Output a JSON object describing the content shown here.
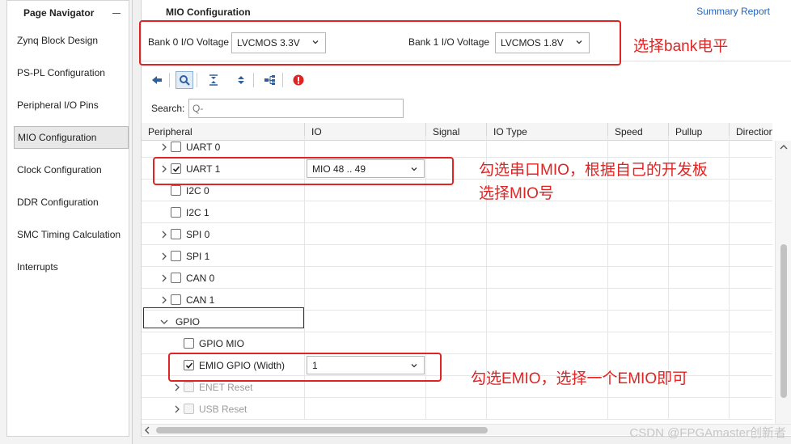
{
  "navigator": {
    "title": "Page Navigator",
    "items": [
      {
        "label": "Zynq Block Design"
      },
      {
        "label": "PS-PL Configuration"
      },
      {
        "label": "Peripheral I/O Pins"
      },
      {
        "label": "MIO Configuration",
        "active": true
      },
      {
        "label": "Clock Configuration"
      },
      {
        "label": "DDR Configuration"
      },
      {
        "label": "SMC Timing Calculation"
      },
      {
        "label": "Interrupts"
      }
    ]
  },
  "main": {
    "title": "MIO Configuration",
    "summary_link": "Summary Report",
    "bank0": {
      "label": "Bank 0 I/O Voltage",
      "value": "LVCMOS 3.3V"
    },
    "bank1": {
      "label": "Bank 1 I/O Voltage",
      "value": "LVCMOS 1.8V"
    },
    "search": {
      "label": "Search:",
      "placeholder": "Q-"
    },
    "columns": [
      "Peripheral",
      "IO",
      "Signal",
      "IO Type",
      "Speed",
      "Pullup",
      "Direction"
    ],
    "rows": [
      {
        "label": "UART 0",
        "checked": false,
        "expander": "collapsed"
      },
      {
        "label": "UART 1",
        "checked": true,
        "expander": "collapsed",
        "io": "MIO 48 .. 49"
      },
      {
        "label": "I2C 0",
        "checked": false,
        "expander": "none"
      },
      {
        "label": "I2C 1",
        "checked": false,
        "expander": "none"
      },
      {
        "label": "SPI 0",
        "checked": false,
        "expander": "collapsed"
      },
      {
        "label": "SPI 1",
        "checked": false,
        "expander": "collapsed"
      },
      {
        "label": "CAN 0",
        "checked": false,
        "expander": "collapsed"
      },
      {
        "label": "CAN 1",
        "checked": false,
        "expander": "collapsed"
      },
      {
        "label": "GPIO",
        "group": true,
        "expander": "expanded"
      },
      {
        "label": "GPIO MIO",
        "checked": false,
        "expander": "none",
        "indent": true
      },
      {
        "label": "EMIO GPIO (Width)",
        "checked": true,
        "expander": "none",
        "indent": true,
        "io": "1"
      },
      {
        "label": "ENET Reset",
        "checked": false,
        "expander": "collapsed",
        "indent": true,
        "disabled": true
      },
      {
        "label": "USB Reset",
        "checked": false,
        "expander": "collapsed",
        "indent": true,
        "disabled": true
      }
    ]
  },
  "annotations": {
    "bank": "选择bank电平",
    "uart_line1": "勾选串口MIO，根据自己的开发板",
    "uart_line2": "选择MIO号",
    "emio": "勾选EMIO，选择一个EMIO即可"
  },
  "watermark": "CSDN @FPGAmaster创新者",
  "colors": {
    "annotation": "#e02424",
    "link": "#1f63c0",
    "error_icon": "#e02424",
    "toolbar_icon": "#2f5f9e"
  }
}
